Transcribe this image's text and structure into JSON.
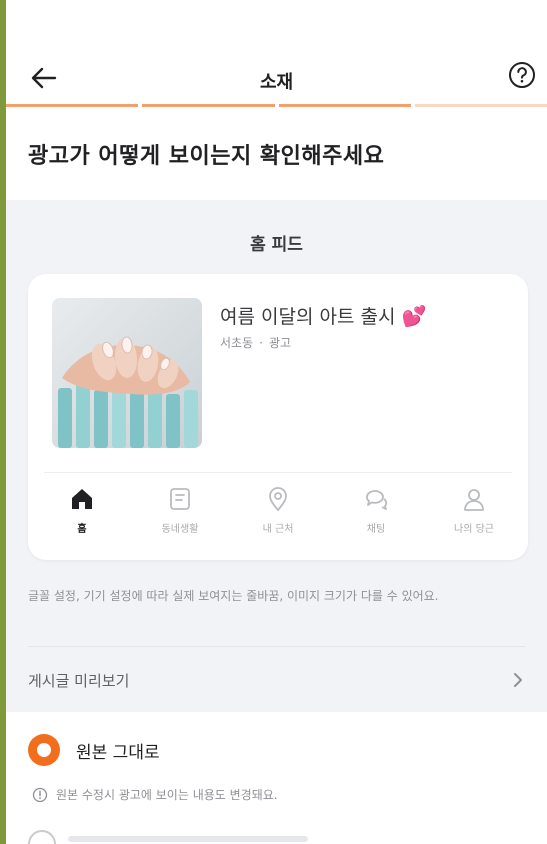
{
  "header": {
    "title": "소재",
    "back_icon": "arrow-left-icon",
    "help_icon": "question-circle-icon"
  },
  "progress": {
    "steps": 3,
    "current": 3
  },
  "page_heading": "광고가 어떻게 보이는지 확인해주세요",
  "preview": {
    "section_label": "홈 피드",
    "item": {
      "title": "여름 이달의 아트 출시",
      "emoji": "💕",
      "location": "서초동",
      "tag": "광고"
    },
    "tabs": [
      {
        "label": "홈",
        "icon": "home-icon",
        "active": true
      },
      {
        "label": "동네생활",
        "icon": "community-icon",
        "active": false
      },
      {
        "label": "내 근처",
        "icon": "location-pin-icon",
        "active": false
      },
      {
        "label": "채팅",
        "icon": "chat-icon",
        "active": false
      },
      {
        "label": "나의 당근",
        "icon": "person-icon",
        "active": false
      }
    ]
  },
  "disclaimer": "글꼴 설정, 기기 설정에 따라 실제 보여지는 줄바꿈, 이미지 크기가 다를 수 있어요.",
  "post_preview_link": "게시글 미리보기",
  "options": {
    "selected_label": "원본 그대로",
    "note": "원본 수정시 광고에 보이는 내용도 변경돼요."
  },
  "colors": {
    "accent": "#f26e1d",
    "progress_active": "#f3a06a",
    "background_gray": "#f2f3f6"
  }
}
